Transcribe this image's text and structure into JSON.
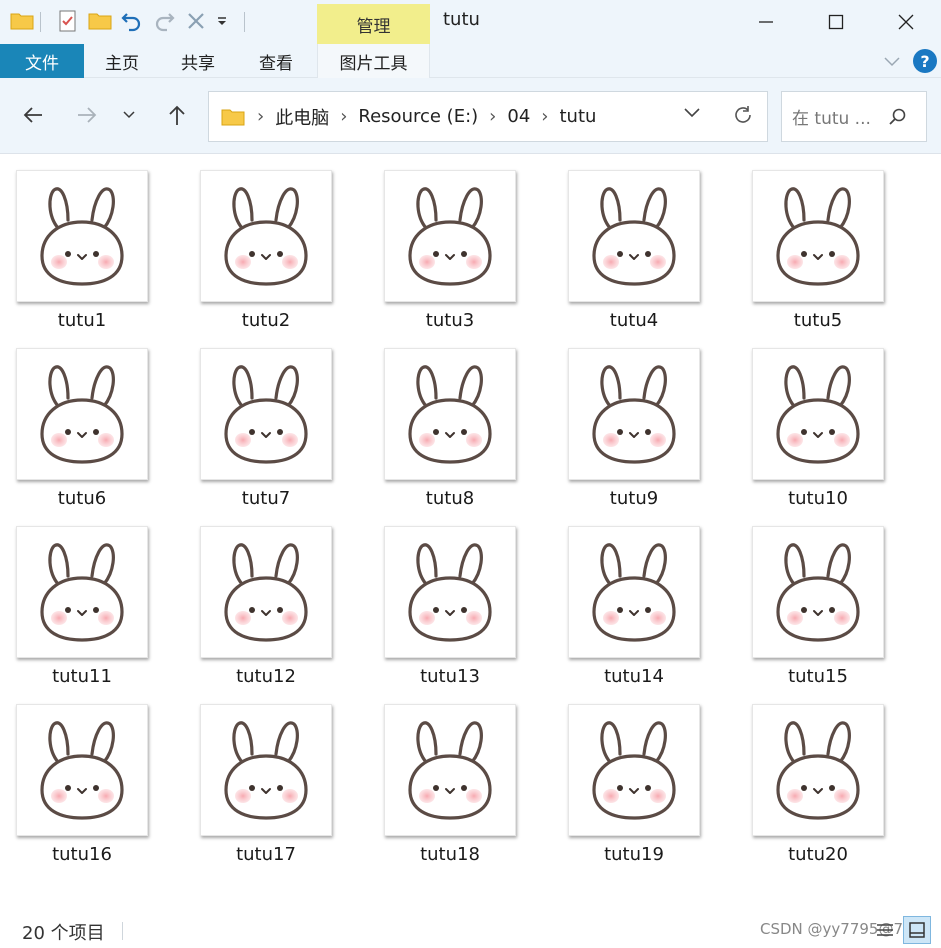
{
  "window": {
    "title": "tutu",
    "manage_label": "管理"
  },
  "ribbon": {
    "file": "文件",
    "home": "主页",
    "share": "共享",
    "view": "查看",
    "picture_tools": "图片工具"
  },
  "address": {
    "crumbs": [
      "此电脑",
      "Resource (E:)",
      "04",
      "tutu"
    ]
  },
  "search": {
    "placeholder": "在 tutu ..."
  },
  "files": [
    "tutu1",
    "tutu2",
    "tutu3",
    "tutu4",
    "tutu5",
    "tutu6",
    "tutu7",
    "tutu8",
    "tutu9",
    "tutu10",
    "tutu11",
    "tutu12",
    "tutu13",
    "tutu14",
    "tutu15",
    "tutu16",
    "tutu17",
    "tutu18",
    "tutu19",
    "tutu20"
  ],
  "status": {
    "count": "20 个项目",
    "watermark": "CSDN @yy7795@7715"
  },
  "colors": {
    "file_tab": "#1a86b8",
    "manage_tab": "#f2ee8c",
    "help": "#1a78c2"
  }
}
